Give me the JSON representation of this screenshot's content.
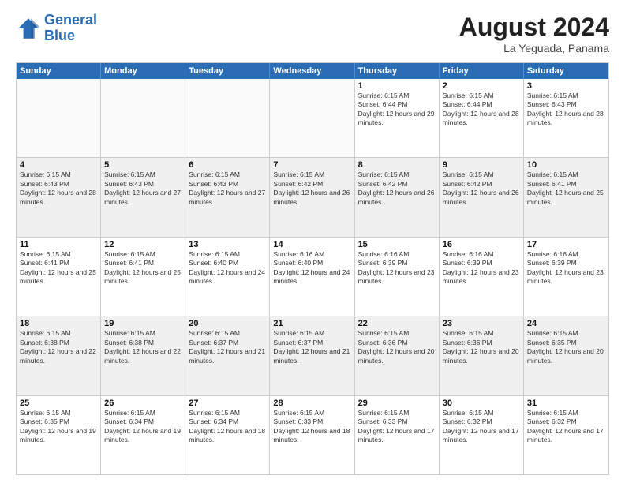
{
  "logo": {
    "line1": "General",
    "line2": "Blue"
  },
  "title": "August 2024",
  "location": "La Yeguada, Panama",
  "days_of_week": [
    "Sunday",
    "Monday",
    "Tuesday",
    "Wednesday",
    "Thursday",
    "Friday",
    "Saturday"
  ],
  "weeks": [
    [
      {
        "day": "",
        "empty": true
      },
      {
        "day": "",
        "empty": true
      },
      {
        "day": "",
        "empty": true
      },
      {
        "day": "",
        "empty": true
      },
      {
        "day": "1",
        "sunrise": "6:15 AM",
        "sunset": "6:44 PM",
        "daylight": "12 hours and 29 minutes."
      },
      {
        "day": "2",
        "sunrise": "6:15 AM",
        "sunset": "6:44 PM",
        "daylight": "12 hours and 28 minutes."
      },
      {
        "day": "3",
        "sunrise": "6:15 AM",
        "sunset": "6:43 PM",
        "daylight": "12 hours and 28 minutes."
      }
    ],
    [
      {
        "day": "4",
        "sunrise": "6:15 AM",
        "sunset": "6:43 PM",
        "daylight": "12 hours and 28 minutes."
      },
      {
        "day": "5",
        "sunrise": "6:15 AM",
        "sunset": "6:43 PM",
        "daylight": "12 hours and 27 minutes."
      },
      {
        "day": "6",
        "sunrise": "6:15 AM",
        "sunset": "6:43 PM",
        "daylight": "12 hours and 27 minutes."
      },
      {
        "day": "7",
        "sunrise": "6:15 AM",
        "sunset": "6:42 PM",
        "daylight": "12 hours and 26 minutes."
      },
      {
        "day": "8",
        "sunrise": "6:15 AM",
        "sunset": "6:42 PM",
        "daylight": "12 hours and 26 minutes."
      },
      {
        "day": "9",
        "sunrise": "6:15 AM",
        "sunset": "6:42 PM",
        "daylight": "12 hours and 26 minutes."
      },
      {
        "day": "10",
        "sunrise": "6:15 AM",
        "sunset": "6:41 PM",
        "daylight": "12 hours and 25 minutes."
      }
    ],
    [
      {
        "day": "11",
        "sunrise": "6:15 AM",
        "sunset": "6:41 PM",
        "daylight": "12 hours and 25 minutes."
      },
      {
        "day": "12",
        "sunrise": "6:15 AM",
        "sunset": "6:41 PM",
        "daylight": "12 hours and 25 minutes."
      },
      {
        "day": "13",
        "sunrise": "6:15 AM",
        "sunset": "6:40 PM",
        "daylight": "12 hours and 24 minutes."
      },
      {
        "day": "14",
        "sunrise": "6:16 AM",
        "sunset": "6:40 PM",
        "daylight": "12 hours and 24 minutes."
      },
      {
        "day": "15",
        "sunrise": "6:16 AM",
        "sunset": "6:39 PM",
        "daylight": "12 hours and 23 minutes."
      },
      {
        "day": "16",
        "sunrise": "6:16 AM",
        "sunset": "6:39 PM",
        "daylight": "12 hours and 23 minutes."
      },
      {
        "day": "17",
        "sunrise": "6:16 AM",
        "sunset": "6:39 PM",
        "daylight": "12 hours and 23 minutes."
      }
    ],
    [
      {
        "day": "18",
        "sunrise": "6:15 AM",
        "sunset": "6:38 PM",
        "daylight": "12 hours and 22 minutes."
      },
      {
        "day": "19",
        "sunrise": "6:15 AM",
        "sunset": "6:38 PM",
        "daylight": "12 hours and 22 minutes."
      },
      {
        "day": "20",
        "sunrise": "6:15 AM",
        "sunset": "6:37 PM",
        "daylight": "12 hours and 21 minutes."
      },
      {
        "day": "21",
        "sunrise": "6:15 AM",
        "sunset": "6:37 PM",
        "daylight": "12 hours and 21 minutes."
      },
      {
        "day": "22",
        "sunrise": "6:15 AM",
        "sunset": "6:36 PM",
        "daylight": "12 hours and 20 minutes."
      },
      {
        "day": "23",
        "sunrise": "6:15 AM",
        "sunset": "6:36 PM",
        "daylight": "12 hours and 20 minutes."
      },
      {
        "day": "24",
        "sunrise": "6:15 AM",
        "sunset": "6:35 PM",
        "daylight": "12 hours and 20 minutes."
      }
    ],
    [
      {
        "day": "25",
        "sunrise": "6:15 AM",
        "sunset": "6:35 PM",
        "daylight": "12 hours and 19 minutes."
      },
      {
        "day": "26",
        "sunrise": "6:15 AM",
        "sunset": "6:34 PM",
        "daylight": "12 hours and 19 minutes."
      },
      {
        "day": "27",
        "sunrise": "6:15 AM",
        "sunset": "6:34 PM",
        "daylight": "12 hours and 18 minutes."
      },
      {
        "day": "28",
        "sunrise": "6:15 AM",
        "sunset": "6:33 PM",
        "daylight": "12 hours and 18 minutes."
      },
      {
        "day": "29",
        "sunrise": "6:15 AM",
        "sunset": "6:33 PM",
        "daylight": "12 hours and 17 minutes."
      },
      {
        "day": "30",
        "sunrise": "6:15 AM",
        "sunset": "6:32 PM",
        "daylight": "12 hours and 17 minutes."
      },
      {
        "day": "31",
        "sunrise": "6:15 AM",
        "sunset": "6:32 PM",
        "daylight": "12 hours and 17 minutes."
      }
    ]
  ]
}
